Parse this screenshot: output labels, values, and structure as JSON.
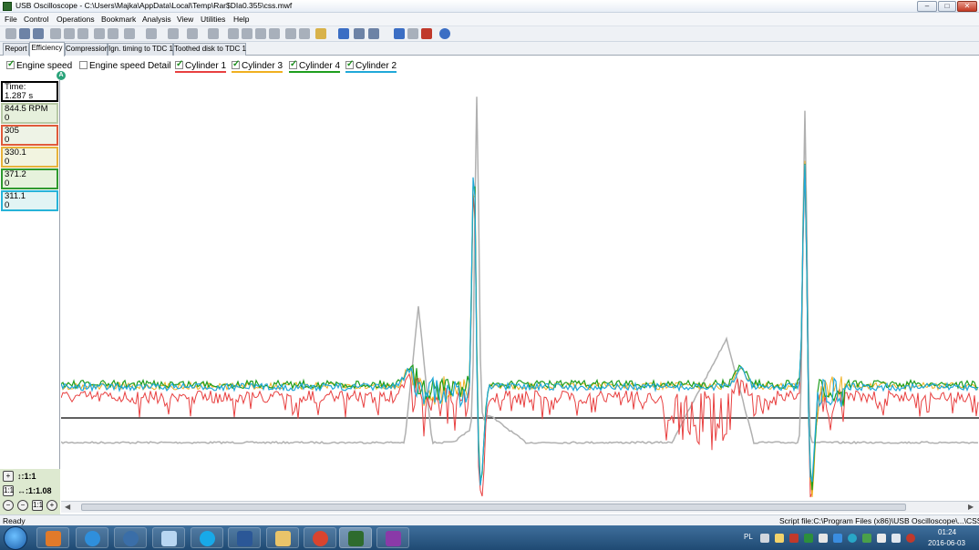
{
  "window": {
    "title": "USB Oscilloscope - C:\\Users\\Majka\\AppData\\Local\\Temp\\Rar$DIa0.355\\css.mwf",
    "buttons": {
      "minimize": "–",
      "maximize": "□",
      "close": "✕"
    }
  },
  "menu": {
    "items": [
      "File",
      "Control",
      "Operations",
      "Bookmark",
      "Analysis",
      "View",
      "Utilities",
      "Help"
    ]
  },
  "tabs": [
    {
      "label": "Report",
      "active": false
    },
    {
      "label": "Efficiency",
      "active": true
    },
    {
      "label": "Compression",
      "active": false
    },
    {
      "label": "Ign. timing to TDC 1",
      "active": false
    },
    {
      "label": "Toothed disk to TDC 1",
      "active": false
    }
  ],
  "legend": [
    {
      "label": "Engine speed",
      "checked": true,
      "color": "#b0b0b0"
    },
    {
      "label": "Engine speed Detail",
      "checked": false,
      "color": "#000000"
    },
    {
      "label": "Cylinder 1",
      "checked": true,
      "color": "#e84040"
    },
    {
      "label": "Cylinder 3",
      "checked": true,
      "color": "#f0b020"
    },
    {
      "label": "Cylinder 4",
      "checked": true,
      "color": "#1e9e1e"
    },
    {
      "label": "Cylinder 2",
      "checked": true,
      "color": "#20a8d8"
    }
  ],
  "marker": {
    "label": "A"
  },
  "readouts": [
    {
      "line1": "Time:",
      "line2": "1.287 s",
      "border": "#000000",
      "bg": "#ffffff"
    },
    {
      "line1": "844.5 RPM",
      "line2": "0",
      "border": "#b7c9a5",
      "bg": "#e6f0dc"
    },
    {
      "line1": "305",
      "line2": "0",
      "border": "#e05a3a",
      "bg": "#eef3e6"
    },
    {
      "line1": "330.1",
      "line2": "0",
      "border": "#e7b23a",
      "bg": "#f2f4e0"
    },
    {
      "line1": "371.2",
      "line2": "0",
      "border": "#2f9a2f",
      "bg": "#e6f2dc"
    },
    {
      "line1": "311.1",
      "line2": "0",
      "border": "#27b3d8",
      "bg": "#e2f4f4"
    }
  ],
  "zoom": {
    "vertical": "↕:1:1",
    "horizontal": "↔:1:1.08",
    "fit_label": "1:1",
    "reset_label": "1:1"
  },
  "status": {
    "left": "Ready",
    "right": "Script file:C:\\Program Files (x86)\\USB Oscilloscope\\...\\CSS.asc"
  },
  "taskbar": {
    "apps": [
      "media-player",
      "internet-explorer",
      "thunderbird",
      "explorer",
      "skype",
      "word",
      "folder",
      "chrome",
      "oscilloscope",
      "winrar"
    ],
    "lang": "PL",
    "time": "01:24",
    "date": "2016-06-03"
  }
}
